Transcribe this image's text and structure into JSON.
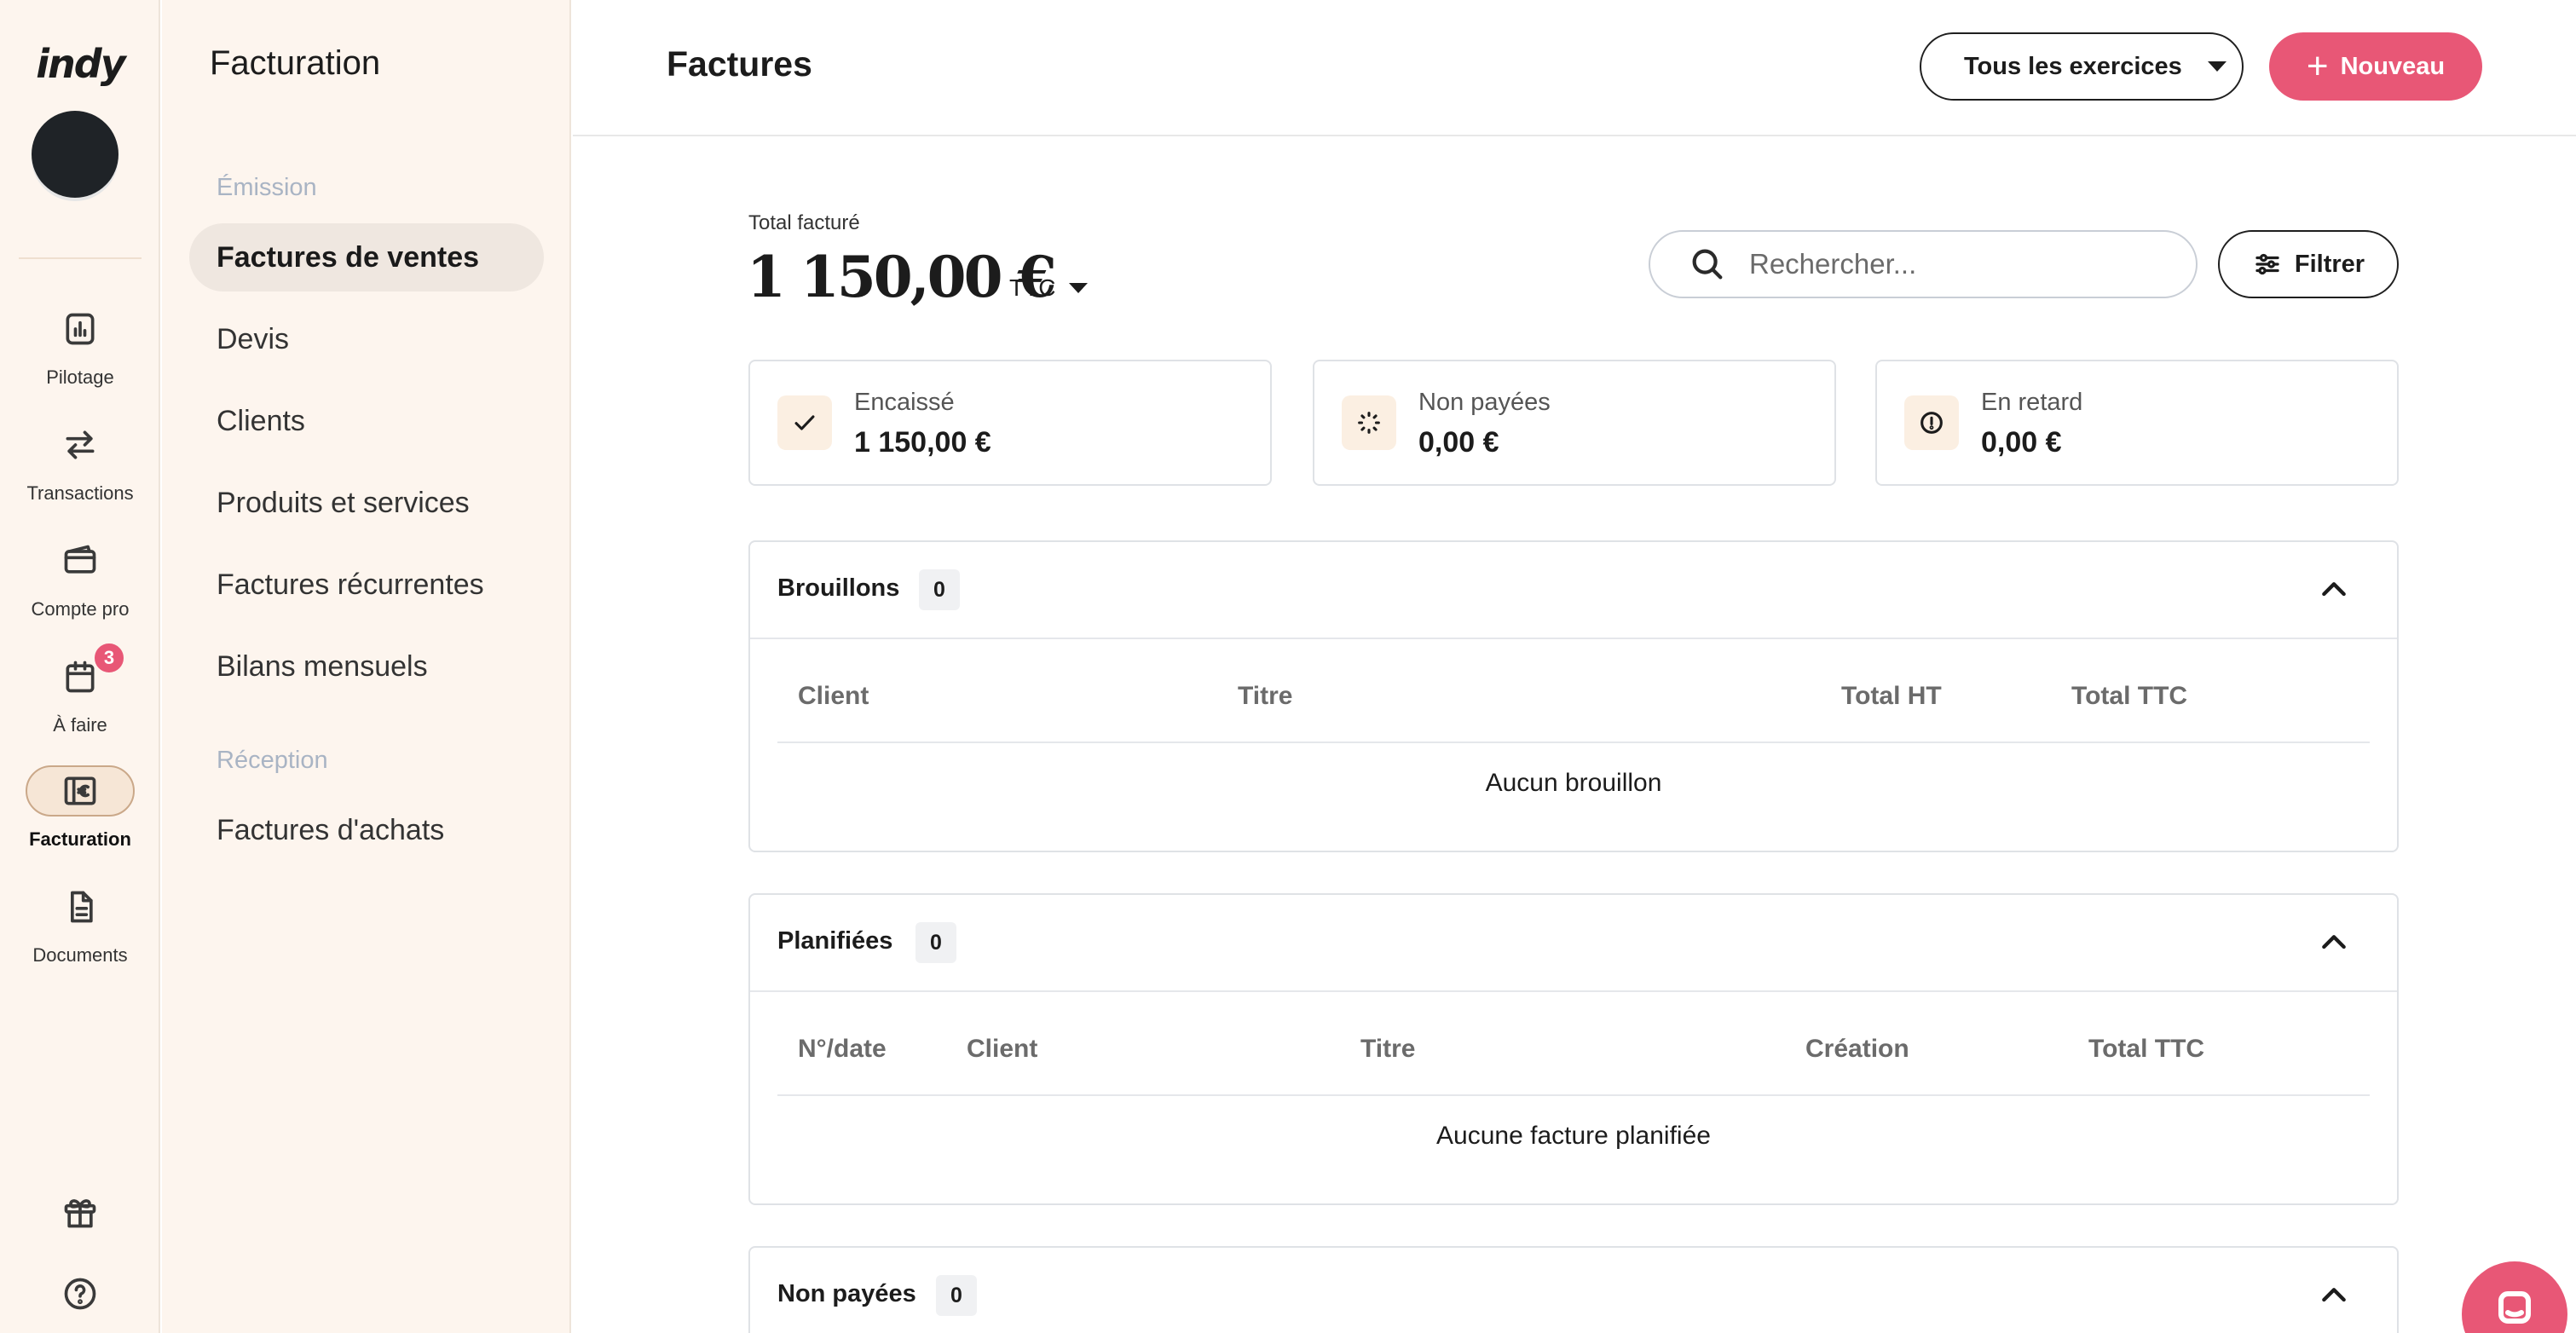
{
  "app": {
    "logo": "indy"
  },
  "rail": {
    "items": [
      {
        "label": "Pilotage",
        "icon": "chart-icon"
      },
      {
        "label": "Transactions",
        "icon": "transfer-arrows-icon"
      },
      {
        "label": "Compte pro",
        "icon": "card-icon"
      },
      {
        "label": "À faire",
        "icon": "calendar-icon",
        "badge": "3"
      },
      {
        "label": "Facturation",
        "icon": "invoice-euro-icon",
        "active": true
      },
      {
        "label": "Documents",
        "icon": "document-icon"
      }
    ],
    "bottom_icons": [
      "gift-icon",
      "help-icon"
    ]
  },
  "subnav": {
    "title": "Facturation",
    "section_emission": "Émission",
    "items_emission": [
      "Factures de ventes",
      "Devis",
      "Clients",
      "Produits et services",
      "Factures récurrentes",
      "Bilans mensuels"
    ],
    "section_reception": "Réception",
    "items_reception": [
      "Factures d'achats"
    ]
  },
  "header": {
    "title": "Factures",
    "exercices_label": "Tous les exercices",
    "new_label": "Nouveau"
  },
  "summary": {
    "total_label": "Total facturé",
    "total_amount": "1 150,00 €",
    "tax_mode": "TTC"
  },
  "search": {
    "placeholder": "Rechercher...",
    "value": ""
  },
  "filter": {
    "label": "Filtrer"
  },
  "stats": [
    {
      "label": "Encaissé",
      "value": "1 150,00 €",
      "icon": "check-icon"
    },
    {
      "label": "Non payées",
      "value": "0,00 €",
      "icon": "spinner-icon"
    },
    {
      "label": "En retard",
      "value": "0,00 €",
      "icon": "alert-circle-icon"
    }
  ],
  "sections": {
    "brouillons": {
      "title": "Brouillons",
      "count": "0",
      "columns": [
        "Client",
        "Titre",
        "Total HT",
        "Total TTC"
      ],
      "empty": "Aucun brouillon"
    },
    "planifiees": {
      "title": "Planifiées",
      "count": "0",
      "columns": [
        "N°/date",
        "Client",
        "Titre",
        "Création",
        "Total TTC"
      ],
      "empty": "Aucune facture planifiée"
    },
    "non_payees": {
      "title": "Non payées",
      "count": "0"
    }
  },
  "colors": {
    "accent": "#e85776",
    "sidebar_bg": "#fdf5ee",
    "text": "#1c1c1c"
  }
}
